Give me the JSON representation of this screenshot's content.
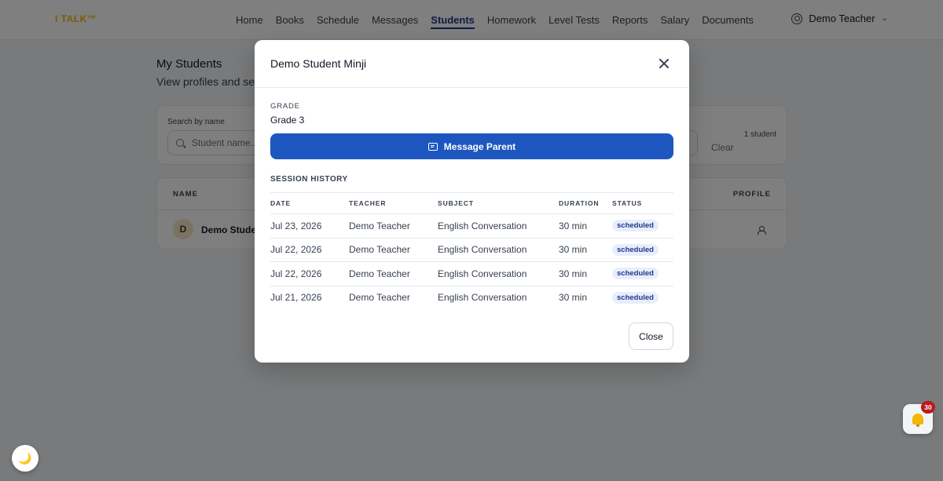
{
  "app": {
    "logo": "I TALK™"
  },
  "nav": {
    "items": [
      {
        "label": "Home"
      },
      {
        "label": "Books"
      },
      {
        "label": "Schedule"
      },
      {
        "label": "Messages"
      },
      {
        "label": "Students",
        "active": true
      },
      {
        "label": "Homework"
      },
      {
        "label": "Level Tests"
      },
      {
        "label": "Reports"
      },
      {
        "label": "Salary"
      },
      {
        "label": "Documents"
      }
    ],
    "user": "Demo Teacher"
  },
  "page": {
    "title": "My Students",
    "subtitle": "View profiles and ses",
    "search": {
      "label": "Search by name",
      "placeholder": "Student name..."
    },
    "clear_label": "Clear",
    "count_label": "1 student",
    "table": {
      "col_name": "NAME",
      "col_profile": "PROFILE",
      "rows": [
        {
          "initial": "D",
          "name": "Demo Studen"
        }
      ]
    }
  },
  "modal": {
    "title": "Demo Student Minji",
    "grade_label": "GRADE",
    "grade_value": "Grade 3",
    "message_button": "Message Parent",
    "history_title": "SESSION HISTORY",
    "columns": [
      "DATE",
      "TEACHER",
      "SUBJECT",
      "DURATION",
      "STATUS"
    ],
    "sessions": [
      {
        "date": "Jul 23, 2026",
        "teacher": "Demo Teacher",
        "subject": "English Conversation",
        "duration": "30 min",
        "status": "scheduled"
      },
      {
        "date": "Jul 22, 2026",
        "teacher": "Demo Teacher",
        "subject": "English Conversation",
        "duration": "30 min",
        "status": "scheduled"
      },
      {
        "date": "Jul 22, 2026",
        "teacher": "Demo Teacher",
        "subject": "English Conversation",
        "duration": "30 min",
        "status": "scheduled"
      },
      {
        "date": "Jul 21, 2026",
        "teacher": "Demo Teacher",
        "subject": "English Conversation",
        "duration": "30 min",
        "status": "scheduled"
      }
    ],
    "close_button": "Close"
  },
  "widgets": {
    "dark_mode_icon": "🌙",
    "notification_count": "30"
  },
  "colors": {
    "accent": "#1e56c0",
    "nav_active": "#1e3a8a",
    "logo": "#f2b705",
    "badge_alert": "#b91c1c"
  }
}
